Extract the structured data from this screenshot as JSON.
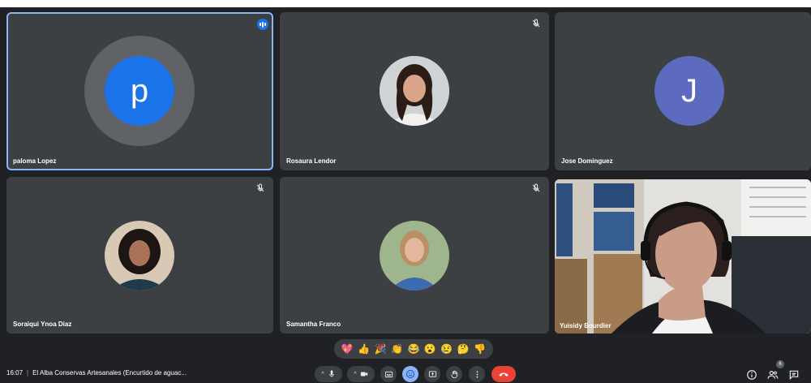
{
  "participants": [
    {
      "name": "paloma Lopez",
      "initial": "p",
      "avatar_color": "#1a73e8",
      "state": "speaking"
    },
    {
      "name": "Rosaura Lendor",
      "state": "muted"
    },
    {
      "name": "Jose Dominguez",
      "initial": "J",
      "avatar_color": "#5c6bc0",
      "state": "none"
    },
    {
      "name": "Soraiqui Ynoa Diaz",
      "state": "muted"
    },
    {
      "name": "Samantha Franco",
      "state": "muted"
    },
    {
      "name": "Yuisidy Bourdier",
      "state": "camera-on"
    }
  ],
  "reactions": [
    "💖",
    "👍",
    "🎉",
    "👏",
    "😂",
    "😮",
    "😢",
    "🤔",
    "👎"
  ],
  "meeting": {
    "time": "16:07",
    "title": "El Alba Conservas Artesanales (Encurtido de aguac..."
  },
  "controls": [
    "mic-icon",
    "camera-icon",
    "captions-icon",
    "emoji-icon",
    "present-icon",
    "raise-hand-icon",
    "more-options-icon",
    "end-call-icon"
  ],
  "people_count": "6",
  "colors": {
    "accent": "#8ab4f8",
    "end_call": "#ea4335",
    "tile_bg": "#3c4043"
  }
}
